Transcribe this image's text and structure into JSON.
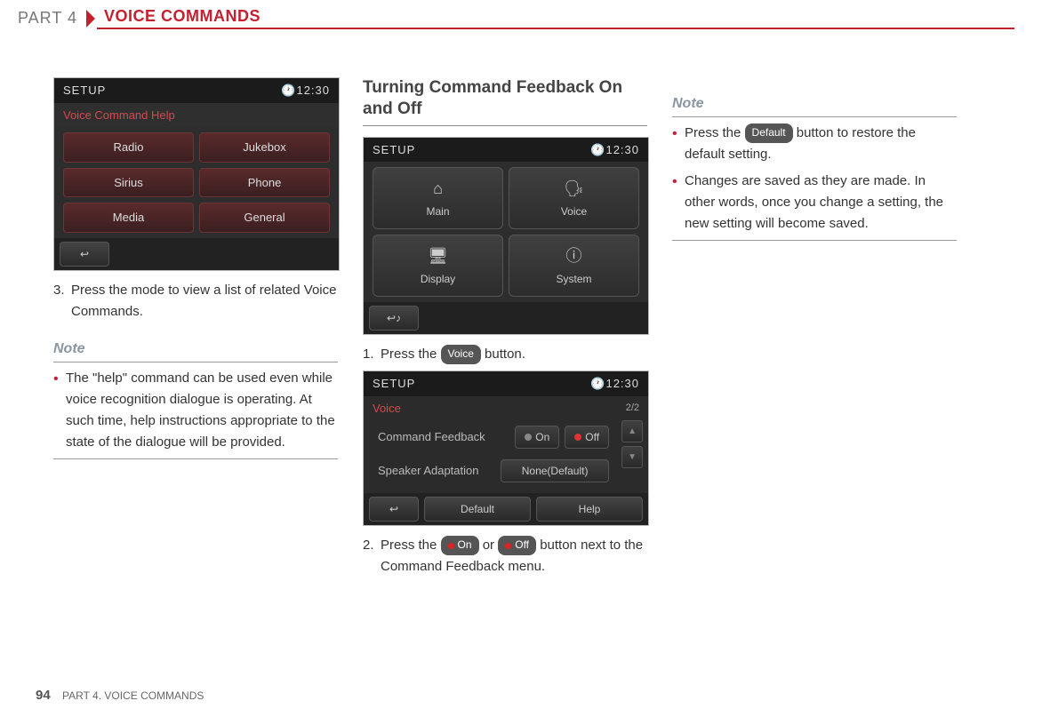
{
  "header": {
    "part": "PART 4",
    "title": "VOICE COMMANDS"
  },
  "col1": {
    "screen1": {
      "title": "SETUP",
      "time": "🕐12:30",
      "sub": "Voice Command Help",
      "tiles": [
        "Radio",
        "Jukebox",
        "Sirius",
        "Phone",
        "Media",
        "General"
      ],
      "back": "↩"
    },
    "step3_num": "3.",
    "step3": "Press the mode to view a list of related Voice Commands.",
    "note_head": "Note",
    "note1": "The \"help\" command can be used even while voice recognition dialogue is operating. At such time, help instructions appropriate to the state of the dialogue will be provided."
  },
  "col2": {
    "section": "Turning Command Feedback On and Off",
    "screen2": {
      "title": "SETUP",
      "time": "🕐12:30",
      "tiles": [
        "Main",
        "Voice",
        "Display",
        "System"
      ],
      "back_icon": "↩♪"
    },
    "step1_num": "1.",
    "step1_pre": "Press the ",
    "step1_chip": "Voice",
    "step1_post": " button.",
    "screen3": {
      "title": "SETUP",
      "time": "🕐12:30",
      "sub": "Voice",
      "page": "2/2",
      "row1_label": "Command Feedback",
      "row1_on": "On",
      "row1_off": "Off",
      "row2_label": "Speaker Adaptation",
      "row2_val": "None(Default)",
      "bottom_back": "↩",
      "bottom_default": "Default",
      "bottom_help": "Help"
    },
    "step2_num": "2.",
    "step2_pre": "Press the ",
    "step2_on": "On",
    "step2_mid": " or ",
    "step2_off": "Off",
    "step2_post": " button next to the Command Feedback menu."
  },
  "col3": {
    "note_head": "Note",
    "note1_pre": "Press the ",
    "note1_chip": "Default",
    "note1_post": " button to restore the default setting.",
    "note2": "Changes are saved as they are made. In other words, once you change a setting, the new setting will become saved."
  },
  "footer": {
    "num": "94",
    "text": "PART 4. VOICE COMMANDS"
  }
}
